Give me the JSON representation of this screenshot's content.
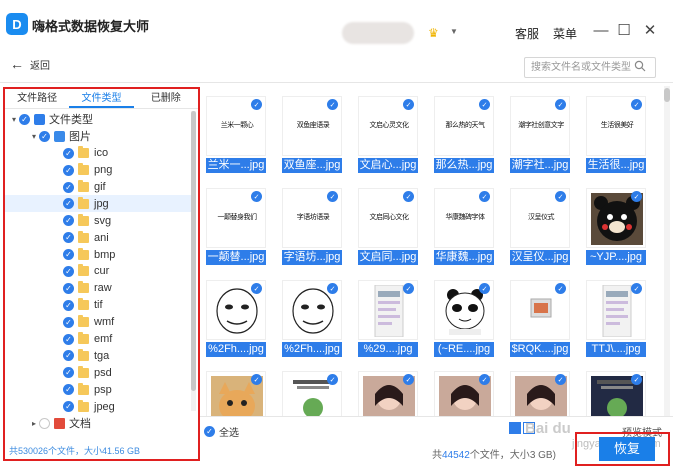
{
  "app": {
    "title": "嗨格式数据恢复大师",
    "logo_letter": "D",
    "links": [
      "客服",
      "菜单"
    ]
  },
  "nav": {
    "back_label": "返回"
  },
  "search": {
    "placeholder": "搜索文件名或文件类型"
  },
  "left_panel": {
    "tabs": [
      {
        "label": "文件路径",
        "active": false
      },
      {
        "label": "文件类型",
        "active": true
      },
      {
        "label": "已删除",
        "active": false
      }
    ],
    "tree": [
      {
        "label": "文件类型",
        "level": 0,
        "expander": "▾",
        "icon": "type"
      },
      {
        "label": "图片",
        "level": 1,
        "expander": "▾",
        "icon": "image"
      },
      {
        "label": "ico",
        "level": 2,
        "icon": "folder"
      },
      {
        "label": "png",
        "level": 2,
        "icon": "folder"
      },
      {
        "label": "gif",
        "level": 2,
        "icon": "folder"
      },
      {
        "label": "jpg",
        "level": 2,
        "icon": "folder",
        "selected": true
      },
      {
        "label": "svg",
        "level": 2,
        "icon": "folder"
      },
      {
        "label": "ani",
        "level": 2,
        "icon": "folder"
      },
      {
        "label": "bmp",
        "level": 2,
        "icon": "folder"
      },
      {
        "label": "cur",
        "level": 2,
        "icon": "folder"
      },
      {
        "label": "raw",
        "level": 2,
        "icon": "folder"
      },
      {
        "label": "tif",
        "level": 2,
        "icon": "folder"
      },
      {
        "label": "wmf",
        "level": 2,
        "icon": "folder"
      },
      {
        "label": "emf",
        "level": 2,
        "icon": "folder"
      },
      {
        "label": "tga",
        "level": 2,
        "icon": "folder"
      },
      {
        "label": "psd",
        "level": 2,
        "icon": "folder"
      },
      {
        "label": "psp",
        "level": 2,
        "icon": "folder"
      },
      {
        "label": "jpeg",
        "level": 2,
        "icon": "folder"
      },
      {
        "label": "文档",
        "level": 1,
        "expander": "▸",
        "icon": "doc",
        "unchecked": true
      }
    ],
    "footer": "共530026个文件，大小41.56 GB"
  },
  "grid": {
    "items": [
      {
        "label": "兰米一...jpg",
        "kind": "text",
        "text": "兰米一颗心"
      },
      {
        "label": "双鱼座...jpg",
        "kind": "text",
        "text": "双鱼座语录"
      },
      {
        "label": "文启心...jpg",
        "kind": "text",
        "text": "文启心灵文化"
      },
      {
        "label": "那么热...jpg",
        "kind": "text",
        "text": "那么热的天气"
      },
      {
        "label": "潮字社...jpg",
        "kind": "text",
        "text": "潮字社创意文字"
      },
      {
        "label": "生活很...jpg",
        "kind": "text",
        "text": "生活很美好"
      },
      {
        "label": "一颠替...jpg",
        "kind": "text",
        "text": "一颠替身我们"
      },
      {
        "label": "字语坊...jpg",
        "kind": "text",
        "text": "字语坊语录"
      },
      {
        "label": "文启同...jpg",
        "kind": "text",
        "text": "文启同心文化"
      },
      {
        "label": "华康魏...jpg",
        "kind": "text",
        "text": "华康魏碑字体"
      },
      {
        "label": "汉呈仪...jpg",
        "kind": "text",
        "text": "汉呈仪式"
      },
      {
        "label": "~YJP....jpg",
        "kind": "bear"
      },
      {
        "label": "%2Fh....jpg",
        "kind": "meme"
      },
      {
        "label": "%2Fh....jpg",
        "kind": "meme"
      },
      {
        "label": "%29....jpg",
        "kind": "phone"
      },
      {
        "label": "(~RE....jpg",
        "kind": "panda"
      },
      {
        "label": "$RQK....jpg",
        "kind": "small"
      },
      {
        "label": "TTJ\\....jpg",
        "kind": "phone2"
      },
      {
        "label": "",
        "kind": "cat"
      },
      {
        "label": "",
        "kind": "poster"
      },
      {
        "label": "",
        "kind": "girl"
      },
      {
        "label": "",
        "kind": "girl2"
      },
      {
        "label": "",
        "kind": "girl3"
      },
      {
        "label": "",
        "kind": "poster2"
      }
    ]
  },
  "bottom": {
    "select_all": "全选",
    "preview_mode": "预览模式",
    "status_prefix": "共",
    "status_count": "44542",
    "status_mid": "个文件，大小",
    "status_size": "3 GB",
    "status_suffix": ")",
    "recover_label": "恢复",
    "watermark": "Bai du",
    "watermark_url": "jingyan.baidu.com"
  }
}
